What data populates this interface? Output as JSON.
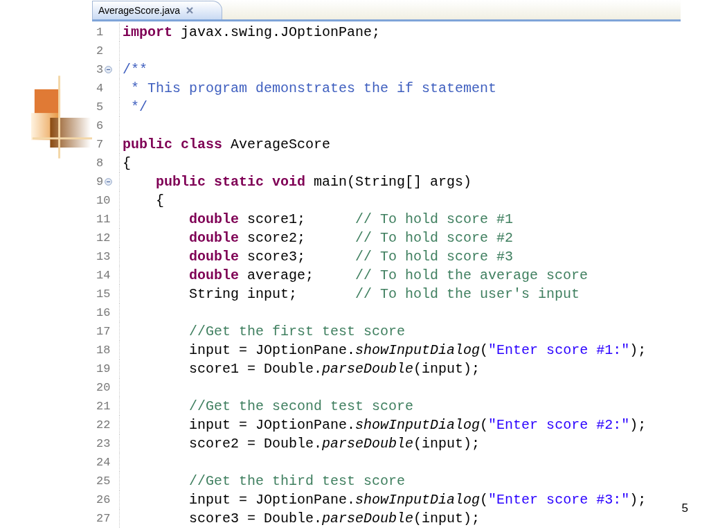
{
  "editor": {
    "tab": {
      "title": "AverageScore.java",
      "selected": true
    },
    "lines": [
      {
        "number": "1",
        "foldable": false,
        "tokens": [
          {
            "kind": "keyword",
            "text": "import"
          },
          {
            "kind": "plain",
            "text": " javax.swing.JOptionPane;"
          }
        ]
      },
      {
        "number": "2",
        "foldable": false
      },
      {
        "number": "3",
        "foldable": true,
        "tokens": [
          {
            "kind": "javadoc",
            "text": "/**"
          }
        ]
      },
      {
        "number": "4",
        "foldable": false,
        "tokens": [
          {
            "kind": "javadoc",
            "text": " * This program demonstrates the if statement"
          }
        ]
      },
      {
        "number": "5",
        "foldable": false,
        "tokens": [
          {
            "kind": "javadoc",
            "text": " */"
          }
        ]
      },
      {
        "number": "6",
        "foldable": false
      },
      {
        "number": "7",
        "foldable": false,
        "tokens": [
          {
            "kind": "keyword",
            "text": "public class"
          },
          {
            "kind": "plain",
            "text": " AverageScore"
          }
        ]
      },
      {
        "number": "8",
        "foldable": false,
        "tokens": [
          {
            "kind": "plain",
            "text": "{"
          }
        ]
      },
      {
        "number": "9",
        "foldable": true,
        "tokens": [
          {
            "kind": "keyword",
            "text": "    public static void"
          },
          {
            "kind": "plain",
            "text": " main(String[] args)"
          }
        ]
      },
      {
        "number": "10",
        "foldable": false,
        "tokens": [
          {
            "kind": "plain",
            "text": "    {"
          }
        ]
      },
      {
        "number": "11",
        "foldable": false,
        "tokens": [
          {
            "kind": "keyword",
            "text": "        double"
          },
          {
            "kind": "plain",
            "text": " score1;      "
          },
          {
            "kind": "comment",
            "text": "// To hold score #1"
          }
        ]
      },
      {
        "number": "12",
        "foldable": false,
        "tokens": [
          {
            "kind": "keyword",
            "text": "        double"
          },
          {
            "kind": "plain",
            "text": " score2;      "
          },
          {
            "kind": "comment",
            "text": "// To hold score #2"
          }
        ]
      },
      {
        "number": "13",
        "foldable": false,
        "tokens": [
          {
            "kind": "keyword",
            "text": "        double"
          },
          {
            "kind": "plain",
            "text": " score3;      "
          },
          {
            "kind": "comment",
            "text": "// To hold score #3"
          }
        ]
      },
      {
        "number": "14",
        "foldable": false,
        "tokens": [
          {
            "kind": "keyword",
            "text": "        double"
          },
          {
            "kind": "plain",
            "text": " average;     "
          },
          {
            "kind": "comment",
            "text": "// To hold the average score"
          }
        ]
      },
      {
        "number": "15",
        "foldable": false,
        "tokens": [
          {
            "kind": "plain",
            "text": "        String input;       "
          },
          {
            "kind": "comment",
            "text": "// To hold the user's input"
          }
        ]
      },
      {
        "number": "16",
        "foldable": false
      },
      {
        "number": "17",
        "foldable": false,
        "tokens": [
          {
            "kind": "comment",
            "text": "        //Get the first test score"
          }
        ]
      },
      {
        "number": "18",
        "foldable": false,
        "tokens": [
          {
            "kind": "plain",
            "text": "        input = JOptionPane."
          },
          {
            "kind": "static_method",
            "text": "showInputDialog"
          },
          {
            "kind": "plain",
            "text": "("
          },
          {
            "kind": "string",
            "text": "\"Enter score #1:\""
          },
          {
            "kind": "plain",
            "text": ");"
          }
        ]
      },
      {
        "number": "19",
        "foldable": false,
        "tokens": [
          {
            "kind": "plain",
            "text": "        score1 = Double."
          },
          {
            "kind": "static_method",
            "text": "parseDouble"
          },
          {
            "kind": "plain",
            "text": "(input);"
          }
        ]
      },
      {
        "number": "20",
        "foldable": false
      },
      {
        "number": "21",
        "foldable": false,
        "tokens": [
          {
            "kind": "comment",
            "text": "        //Get the second test score"
          }
        ]
      },
      {
        "number": "22",
        "foldable": false,
        "tokens": [
          {
            "kind": "plain",
            "text": "        input = JOptionPane."
          },
          {
            "kind": "static_method",
            "text": "showInputDialog"
          },
          {
            "kind": "plain",
            "text": "("
          },
          {
            "kind": "string",
            "text": "\"Enter score #2:\""
          },
          {
            "kind": "plain",
            "text": ");"
          }
        ]
      },
      {
        "number": "23",
        "foldable": false,
        "tokens": [
          {
            "kind": "plain",
            "text": "        score2 = Double."
          },
          {
            "kind": "static_method",
            "text": "parseDouble"
          },
          {
            "kind": "plain",
            "text": "(input);"
          }
        ]
      },
      {
        "number": "24",
        "foldable": false
      },
      {
        "number": "25",
        "foldable": false,
        "tokens": [
          {
            "kind": "comment",
            "text": "        //Get the third test score"
          }
        ]
      },
      {
        "number": "26",
        "foldable": false,
        "tokens": [
          {
            "kind": "plain",
            "text": "        input = JOptionPane."
          },
          {
            "kind": "static_method",
            "text": "showInputDialog"
          },
          {
            "kind": "plain",
            "text": "("
          },
          {
            "kind": "string",
            "text": "\"Enter score #3:\""
          },
          {
            "kind": "plain",
            "text": ");"
          }
        ]
      },
      {
        "number": "27",
        "foldable": false,
        "tokens": [
          {
            "kind": "plain",
            "text": "        score3 = Double."
          },
          {
            "kind": "static_method",
            "text": "parseDouble"
          },
          {
            "kind": "plain",
            "text": "(input);"
          }
        ]
      }
    ]
  },
  "slide_number": "5"
}
